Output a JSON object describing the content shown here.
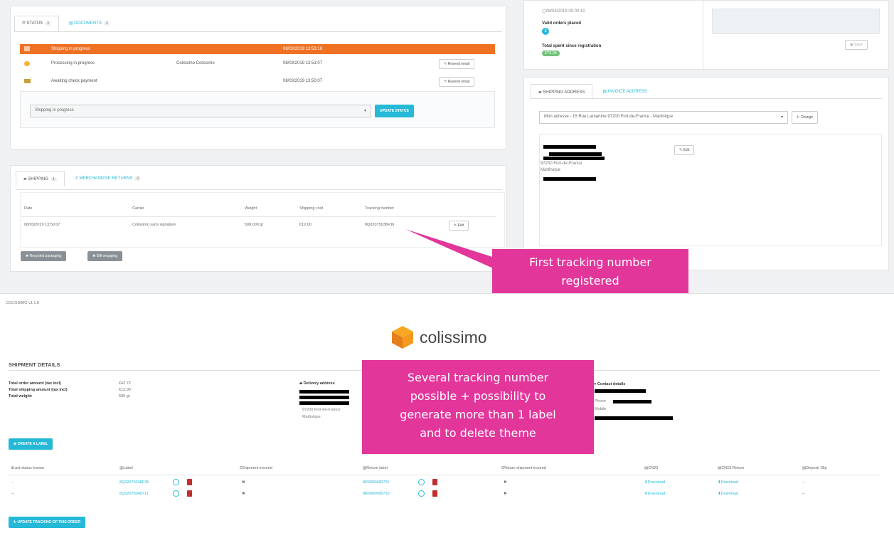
{
  "top_left": {
    "tabs": [
      {
        "label": "STATUS",
        "count": "3"
      },
      {
        "label": "DOCUMENTS",
        "count": "2"
      }
    ],
    "status_rows": [
      {
        "status": "Shipping in progress",
        "employee": "",
        "date": "08/03/2019 13:53:18",
        "action": ""
      },
      {
        "status": "Processing in progress",
        "employee": "Colissimo Colissimo",
        "date": "08/03/2019 13:51:07",
        "action": "Resend email"
      },
      {
        "status": "Awaiting check payment",
        "employee": "",
        "date": "08/03/2019 13:50:07",
        "action": "Resend email"
      }
    ],
    "status_select": "Shipping in progress",
    "update_status": "UPDATE STATUS"
  },
  "shipping_panel": {
    "tabs": [
      {
        "label": "SHIPPING",
        "count": "1"
      },
      {
        "label": "MERCHANDISE RETURNS",
        "count": "0"
      }
    ],
    "headers": [
      "Date",
      "Carrier",
      "Weight",
      "Shipping cost",
      "Tracking number"
    ],
    "row": {
      "date": "08/03/2019 13:50:07",
      "carrier": "Colissimo sans signature",
      "weight": "500.000 gr",
      "cost": "€12.00",
      "tracking": "8Q02075038F36",
      "edit": "Edit"
    },
    "buttons": [
      "Recycled packaging",
      "Gift wrapping"
    ]
  },
  "customer": {
    "registered": "08/03/2019 00:00:10",
    "valid_orders_label": "Valid orders placed",
    "valid_orders_count": "3",
    "total_spent_label": "Total spent since registration",
    "total_spent_value": "€72.04",
    "save": "Save"
  },
  "address_panel": {
    "tabs": [
      "SHIPPING ADDRESS",
      "INVOICE ADDRESS"
    ],
    "select": "Mon adresse - 15 Rue Lamartine 97200 Fort-de-France - Martinique",
    "change": "Change",
    "lines": [
      "97200 Fort-de-France",
      "Martinique"
    ],
    "edit": "Edit"
  },
  "callout1": [
    "First tracking number",
    "registered"
  ],
  "module_version": "COLISSIMO v1.1.8",
  "brand": "colissimo",
  "shipment": {
    "title": "SHIPMENT DETAILS",
    "summary_labels": [
      "Total order amount (tax incl)",
      "Total shipping amount (tax incl)",
      "Total weight:"
    ],
    "summary_values": [
      "€42.72",
      "€12.00",
      "500 gr"
    ],
    "delivery_title": "Delivery address",
    "delivery_lines": [
      "97200 Fort-de-France",
      "Martinique"
    ],
    "contact_title": "Contact details",
    "contact_lines": [
      "Phone",
      "Mobile"
    ],
    "create_label": "CREATE A LABEL",
    "headers": [
      "Last status known",
      "Label",
      "Shipment insured",
      "Return label",
      "Return shipment insured",
      "CN23",
      "CN23 Return",
      "Deposit Slip"
    ],
    "rows": [
      {
        "status": "--",
        "label": "8Q02075038F36",
        "insured": "✖",
        "return_label": "8R0000680701",
        "return_insured": "✖",
        "cn23": "Download",
        "cn23r": "Download",
        "deposit": "--"
      },
      {
        "status": "--",
        "label": "8Q02075040711",
        "insured": "✖",
        "return_label": "8R0000680710",
        "return_insured": "✖",
        "cn23": "Download",
        "cn23r": "Download",
        "deposit": "--"
      }
    ],
    "update_tracking": "UPDATE TRACKING OF THIS ORDER"
  },
  "callout2": [
    "Several tracking number",
    "possible + possibility to",
    "generate more than 1 label",
    "and to delete theme"
  ],
  "colors": {
    "accent": "#25b9d7",
    "orange": "#ef7124",
    "callout": "#e2369b",
    "danger": "#c12e2e"
  }
}
